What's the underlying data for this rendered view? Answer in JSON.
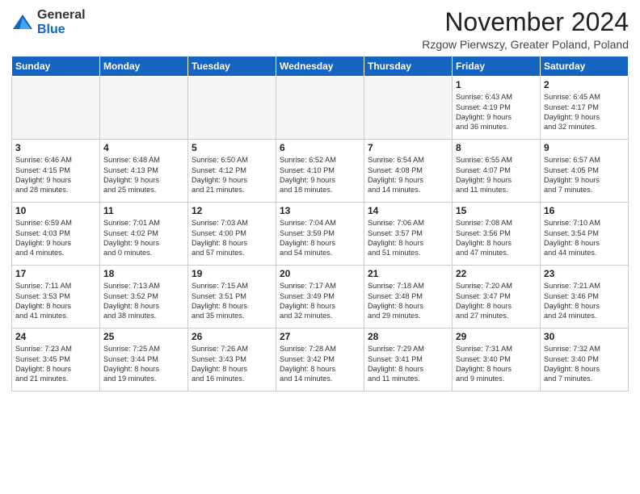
{
  "logo": {
    "general": "General",
    "blue": "Blue"
  },
  "title": "November 2024",
  "location": "Rzgow Pierwszy, Greater Poland, Poland",
  "headers": [
    "Sunday",
    "Monday",
    "Tuesday",
    "Wednesday",
    "Thursday",
    "Friday",
    "Saturday"
  ],
  "weeks": [
    [
      {
        "day": "",
        "info": "",
        "empty": true
      },
      {
        "day": "",
        "info": "",
        "empty": true
      },
      {
        "day": "",
        "info": "",
        "empty": true
      },
      {
        "day": "",
        "info": "",
        "empty": true
      },
      {
        "day": "",
        "info": "",
        "empty": true
      },
      {
        "day": "1",
        "info": "Sunrise: 6:43 AM\nSunset: 4:19 PM\nDaylight: 9 hours\nand 36 minutes."
      },
      {
        "day": "2",
        "info": "Sunrise: 6:45 AM\nSunset: 4:17 PM\nDaylight: 9 hours\nand 32 minutes."
      }
    ],
    [
      {
        "day": "3",
        "info": "Sunrise: 6:46 AM\nSunset: 4:15 PM\nDaylight: 9 hours\nand 28 minutes."
      },
      {
        "day": "4",
        "info": "Sunrise: 6:48 AM\nSunset: 4:13 PM\nDaylight: 9 hours\nand 25 minutes."
      },
      {
        "day": "5",
        "info": "Sunrise: 6:50 AM\nSunset: 4:12 PM\nDaylight: 9 hours\nand 21 minutes."
      },
      {
        "day": "6",
        "info": "Sunrise: 6:52 AM\nSunset: 4:10 PM\nDaylight: 9 hours\nand 18 minutes."
      },
      {
        "day": "7",
        "info": "Sunrise: 6:54 AM\nSunset: 4:08 PM\nDaylight: 9 hours\nand 14 minutes."
      },
      {
        "day": "8",
        "info": "Sunrise: 6:55 AM\nSunset: 4:07 PM\nDaylight: 9 hours\nand 11 minutes."
      },
      {
        "day": "9",
        "info": "Sunrise: 6:57 AM\nSunset: 4:05 PM\nDaylight: 9 hours\nand 7 minutes."
      }
    ],
    [
      {
        "day": "10",
        "info": "Sunrise: 6:59 AM\nSunset: 4:03 PM\nDaylight: 9 hours\nand 4 minutes."
      },
      {
        "day": "11",
        "info": "Sunrise: 7:01 AM\nSunset: 4:02 PM\nDaylight: 9 hours\nand 0 minutes."
      },
      {
        "day": "12",
        "info": "Sunrise: 7:03 AM\nSunset: 4:00 PM\nDaylight: 8 hours\nand 57 minutes."
      },
      {
        "day": "13",
        "info": "Sunrise: 7:04 AM\nSunset: 3:59 PM\nDaylight: 8 hours\nand 54 minutes."
      },
      {
        "day": "14",
        "info": "Sunrise: 7:06 AM\nSunset: 3:57 PM\nDaylight: 8 hours\nand 51 minutes."
      },
      {
        "day": "15",
        "info": "Sunrise: 7:08 AM\nSunset: 3:56 PM\nDaylight: 8 hours\nand 47 minutes."
      },
      {
        "day": "16",
        "info": "Sunrise: 7:10 AM\nSunset: 3:54 PM\nDaylight: 8 hours\nand 44 minutes."
      }
    ],
    [
      {
        "day": "17",
        "info": "Sunrise: 7:11 AM\nSunset: 3:53 PM\nDaylight: 8 hours\nand 41 minutes."
      },
      {
        "day": "18",
        "info": "Sunrise: 7:13 AM\nSunset: 3:52 PM\nDaylight: 8 hours\nand 38 minutes."
      },
      {
        "day": "19",
        "info": "Sunrise: 7:15 AM\nSunset: 3:51 PM\nDaylight: 8 hours\nand 35 minutes."
      },
      {
        "day": "20",
        "info": "Sunrise: 7:17 AM\nSunset: 3:49 PM\nDaylight: 8 hours\nand 32 minutes."
      },
      {
        "day": "21",
        "info": "Sunrise: 7:18 AM\nSunset: 3:48 PM\nDaylight: 8 hours\nand 29 minutes."
      },
      {
        "day": "22",
        "info": "Sunrise: 7:20 AM\nSunset: 3:47 PM\nDaylight: 8 hours\nand 27 minutes."
      },
      {
        "day": "23",
        "info": "Sunrise: 7:21 AM\nSunset: 3:46 PM\nDaylight: 8 hours\nand 24 minutes."
      }
    ],
    [
      {
        "day": "24",
        "info": "Sunrise: 7:23 AM\nSunset: 3:45 PM\nDaylight: 8 hours\nand 21 minutes."
      },
      {
        "day": "25",
        "info": "Sunrise: 7:25 AM\nSunset: 3:44 PM\nDaylight: 8 hours\nand 19 minutes."
      },
      {
        "day": "26",
        "info": "Sunrise: 7:26 AM\nSunset: 3:43 PM\nDaylight: 8 hours\nand 16 minutes."
      },
      {
        "day": "27",
        "info": "Sunrise: 7:28 AM\nSunset: 3:42 PM\nDaylight: 8 hours\nand 14 minutes."
      },
      {
        "day": "28",
        "info": "Sunrise: 7:29 AM\nSunset: 3:41 PM\nDaylight: 8 hours\nand 11 minutes."
      },
      {
        "day": "29",
        "info": "Sunrise: 7:31 AM\nSunset: 3:40 PM\nDaylight: 8 hours\nand 9 minutes."
      },
      {
        "day": "30",
        "info": "Sunrise: 7:32 AM\nSunset: 3:40 PM\nDaylight: 8 hours\nand 7 minutes."
      }
    ]
  ]
}
